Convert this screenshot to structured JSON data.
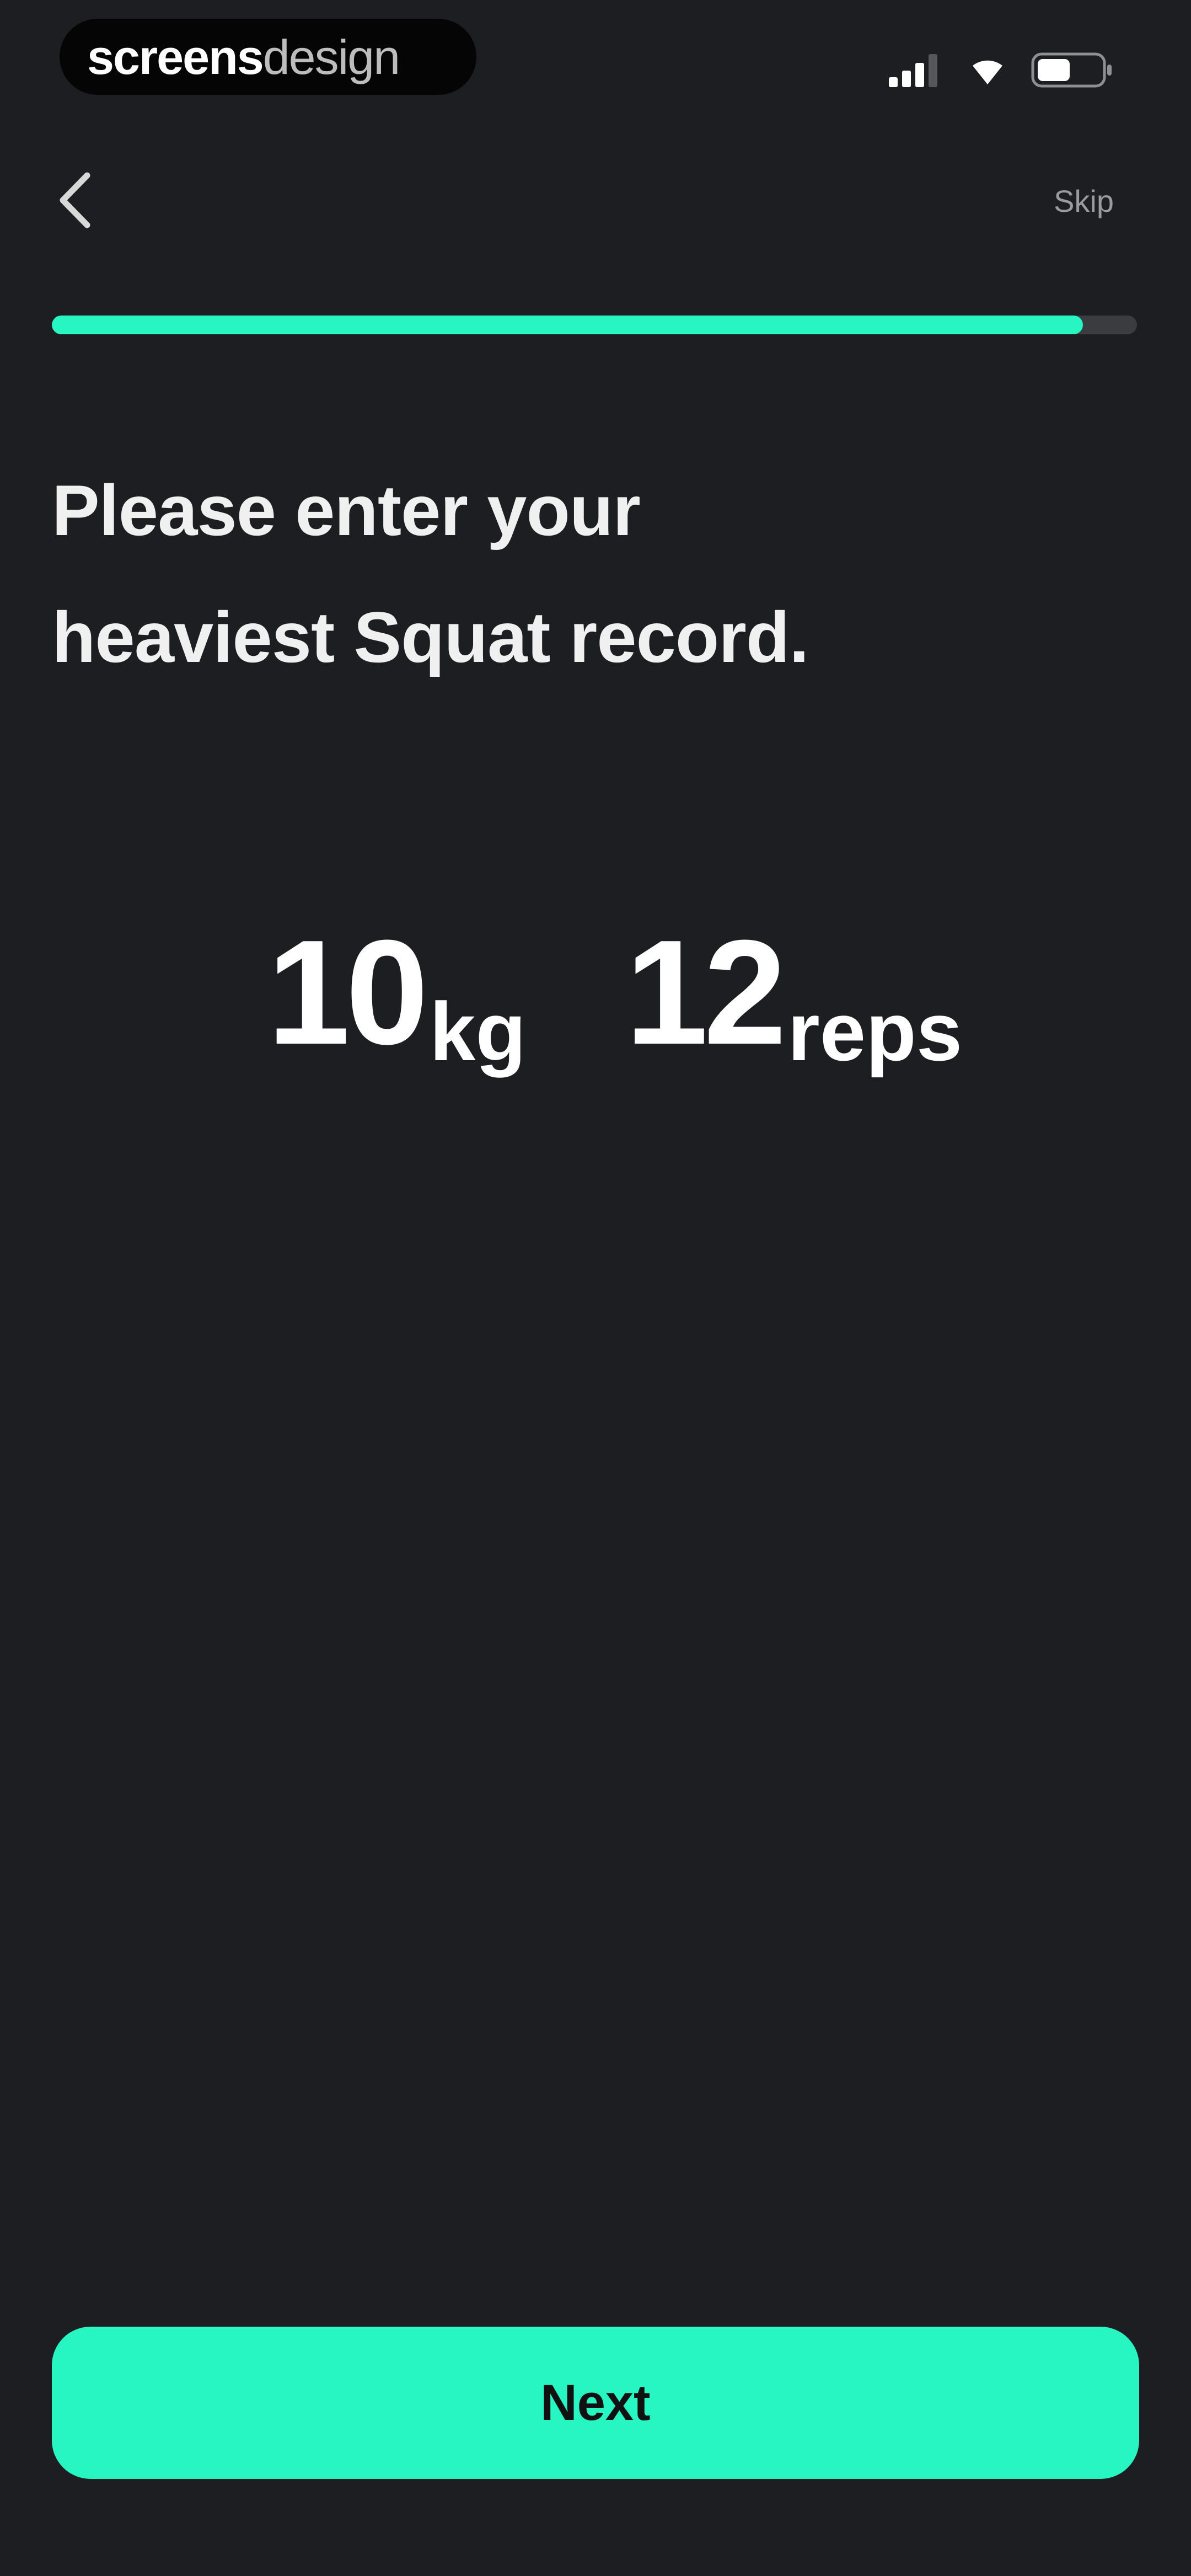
{
  "status_bar": {
    "brand_strong": "screens",
    "brand_light": "design",
    "icons": [
      "signal-icon",
      "wifi-icon",
      "battery-icon"
    ]
  },
  "nav": {
    "back_icon": "chevron-left-icon",
    "skip_label": "Skip"
  },
  "progress": {
    "fraction": 0.95,
    "color": "#27f5c2",
    "track_color": "#3a3c40"
  },
  "heading": {
    "line1": "Please enter your",
    "line2": "heaviest Squat record."
  },
  "record": {
    "weight_value": "10",
    "weight_unit": "kg",
    "reps_value": "12",
    "reps_unit": "reps"
  },
  "next_button": {
    "label": "Next",
    "color": "#27f5c2"
  },
  "colors": {
    "background": "#1d1e21",
    "accent": "#27f5c2"
  }
}
